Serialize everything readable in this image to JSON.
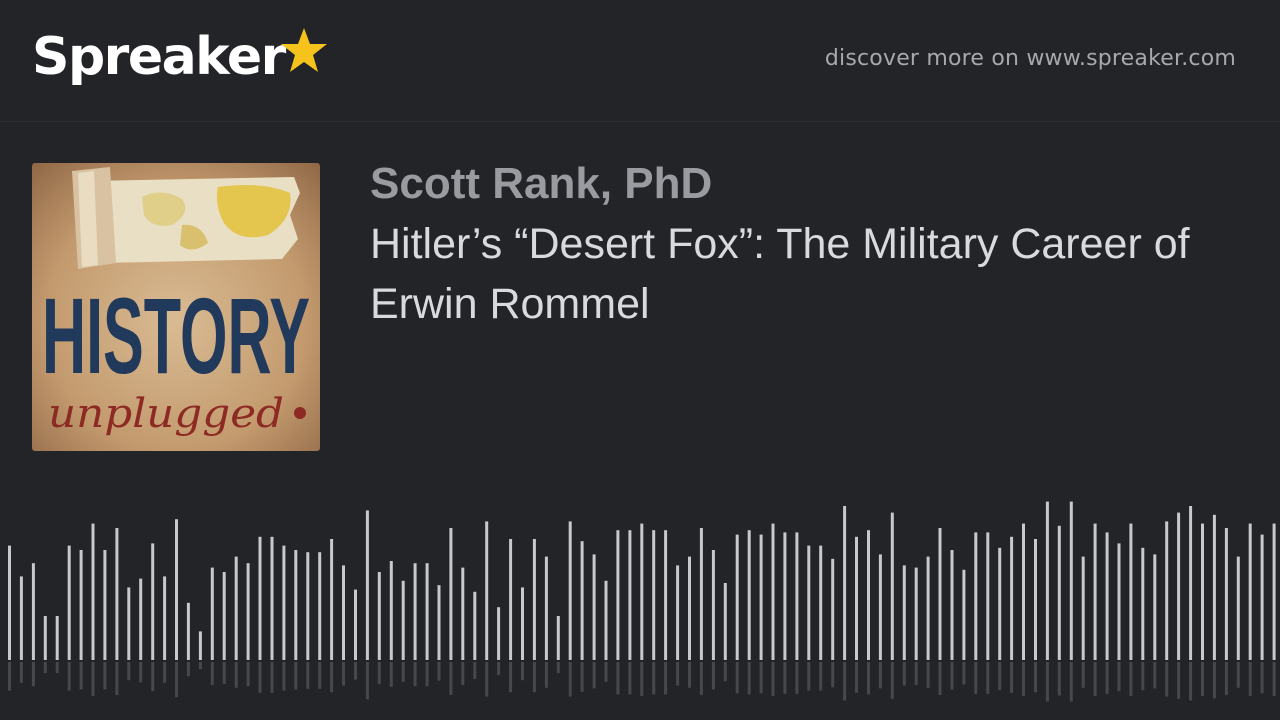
{
  "header": {
    "logo_text": "Spreaker",
    "logo_star_color": "#f6c31c",
    "discover_text": "discover more on www.spreaker.com"
  },
  "cover": {
    "title_line1": "HISTORY",
    "title_line2": "unplugged"
  },
  "episode": {
    "author": "Scott Rank, PhD",
    "title": "Hitler’s “Desert Fox”: The Military Career of Erwin Rommel"
  },
  "colors": {
    "background": "#232428",
    "waveform_bar": "#c8c9cc",
    "author_text": "#9a9ba0",
    "title_text": "#d9dadd"
  },
  "waveform": {
    "levels": [
      0.52,
      0.38,
      0.44,
      0.2,
      0.2,
      0.52,
      0.5,
      0.62,
      0.5,
      0.6,
      0.33,
      0.37,
      0.53,
      0.38,
      0.64,
      0.26,
      0.13,
      0.42,
      0.4,
      0.47,
      0.44,
      0.56,
      0.56,
      0.52,
      0.5,
      0.49,
      0.49,
      0.55,
      0.43,
      0.32,
      0.68,
      0.4,
      0.45,
      0.36,
      0.44,
      0.44,
      0.34,
      0.6,
      0.42,
      0.31,
      0.63,
      0.24,
      0.55,
      0.33,
      0.55,
      0.47,
      0.2,
      0.63,
      0.54,
      0.48,
      0.36,
      0.59,
      0.59,
      0.62,
      0.59,
      0.59,
      0.43,
      0.47,
      0.6,
      0.5,
      0.35,
      0.57,
      0.59,
      0.57,
      0.62,
      0.58,
      0.58,
      0.52,
      0.52,
      0.46,
      0.7,
      0.56,
      0.59,
      0.48,
      0.67,
      0.43,
      0.42,
      0.47,
      0.6,
      0.5,
      0.41,
      0.58,
      0.58,
      0.51,
      0.56,
      0.62,
      0.55,
      0.72,
      0.61,
      0.72,
      0.47,
      0.62,
      0.58,
      0.53,
      0.62,
      0.51,
      0.48,
      0.63,
      0.67,
      0.7,
      0.62,
      0.66,
      0.6,
      0.47,
      0.62,
      0.57,
      0.62,
      0.53,
      0.51,
      0.64,
      0.56,
      0.52,
      0.7,
      0.62,
      0.6,
      0.5,
      0.41,
      0.45,
      0.53,
      0.57,
      0.55,
      0.43,
      0.2
    ]
  }
}
